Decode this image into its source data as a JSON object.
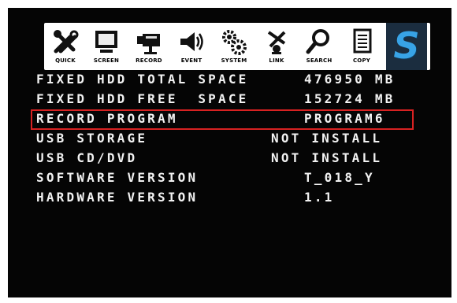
{
  "toolbar": {
    "tabs": [
      {
        "label": "QUICK",
        "icon": "tools-icon"
      },
      {
        "label": "SCREEN",
        "icon": "monitor-icon"
      },
      {
        "label": "RECORD",
        "icon": "camera-icon"
      },
      {
        "label": "EVENT",
        "icon": "alarm-speaker-icon"
      },
      {
        "label": "SYSTEM",
        "icon": "gears-icon"
      },
      {
        "label": "LINK",
        "icon": "network-link-icon"
      },
      {
        "label": "SEARCH",
        "icon": "magnifier-icon"
      },
      {
        "label": "COPY",
        "icon": "document-copy-icon"
      },
      {
        "label": "S",
        "icon": "status-icon",
        "active": true
      }
    ]
  },
  "rows": [
    {
      "label": "FIXED HDD TOTAL SPACE",
      "value": "476950 MB"
    },
    {
      "label": "FIXED HDD FREE  SPACE",
      "value": "152724 MB"
    },
    {
      "label": "RECORD PROGRAM",
      "value": "PROGRAM6",
      "selected": true
    },
    {
      "label": "USB STORAGE",
      "value": "NOT INSTALL"
    },
    {
      "label": "USB CD/DVD",
      "value": "NOT INSTALL"
    },
    {
      "label": "SOFTWARE VERSION",
      "value": "T_018_Y"
    },
    {
      "label": "HARDWARE VERSION",
      "value": "1.1"
    }
  ],
  "colors": {
    "screen": "#050505",
    "text": "#f2f2f2",
    "selection": "#d82222",
    "active_tab": "#1b2d3f",
    "active_glyph": "#38a3e6"
  }
}
